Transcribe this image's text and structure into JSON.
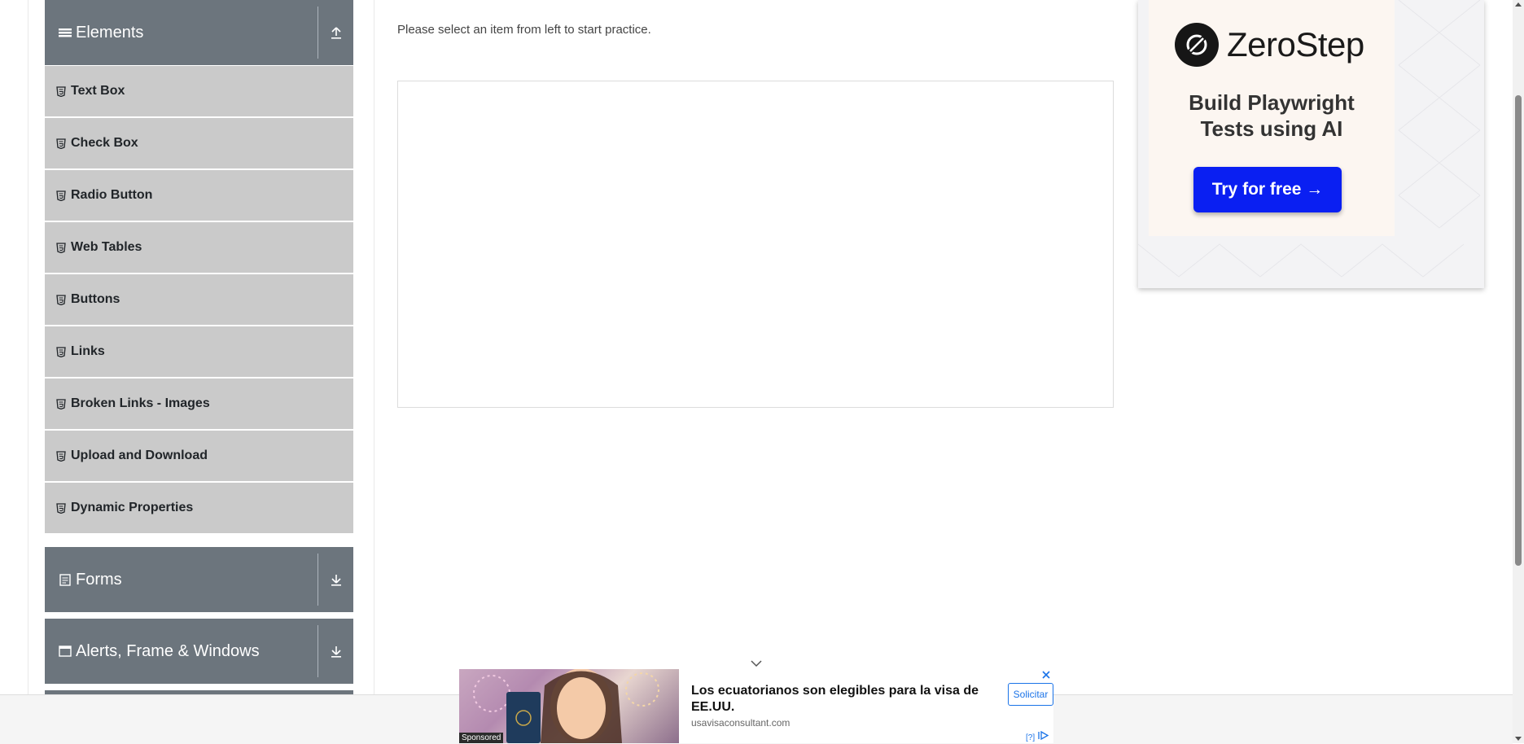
{
  "main": {
    "prompt": "Please select an item from left to start practice."
  },
  "sidebar": {
    "groups": [
      {
        "title": "Elements",
        "icon": "hamburger-icon",
        "expanded": true
      },
      {
        "title": "Forms",
        "icon": "form-icon",
        "expanded": false
      },
      {
        "title": "Alerts, Frame & Windows",
        "icon": "window-icon",
        "expanded": false
      }
    ],
    "elements_items": [
      {
        "label": "Text Box"
      },
      {
        "label": "Check Box"
      },
      {
        "label": "Radio Button"
      },
      {
        "label": "Web Tables"
      },
      {
        "label": "Buttons"
      },
      {
        "label": "Links"
      },
      {
        "label": "Broken Links - Images"
      },
      {
        "label": "Upload and Download"
      },
      {
        "label": "Dynamic Properties"
      }
    ],
    "colors": {
      "header_bg": "#6c757d",
      "item_bg": "#cacaca"
    }
  },
  "ad_right": {
    "brand": "ZeroStep",
    "tagline_line1": "Build Playwright",
    "tagline_line2": "Tests using AI",
    "cta": "Try for free →",
    "cta_color": "#0a1ff2"
  },
  "ad_bottom": {
    "sponsored": "Sponsored",
    "title": "Los ecuatorianos son elegibles para la visa de EE.UU.",
    "url": "usavisaconsultant.com",
    "cta": "Solicitar",
    "adchoice": "[?]"
  }
}
